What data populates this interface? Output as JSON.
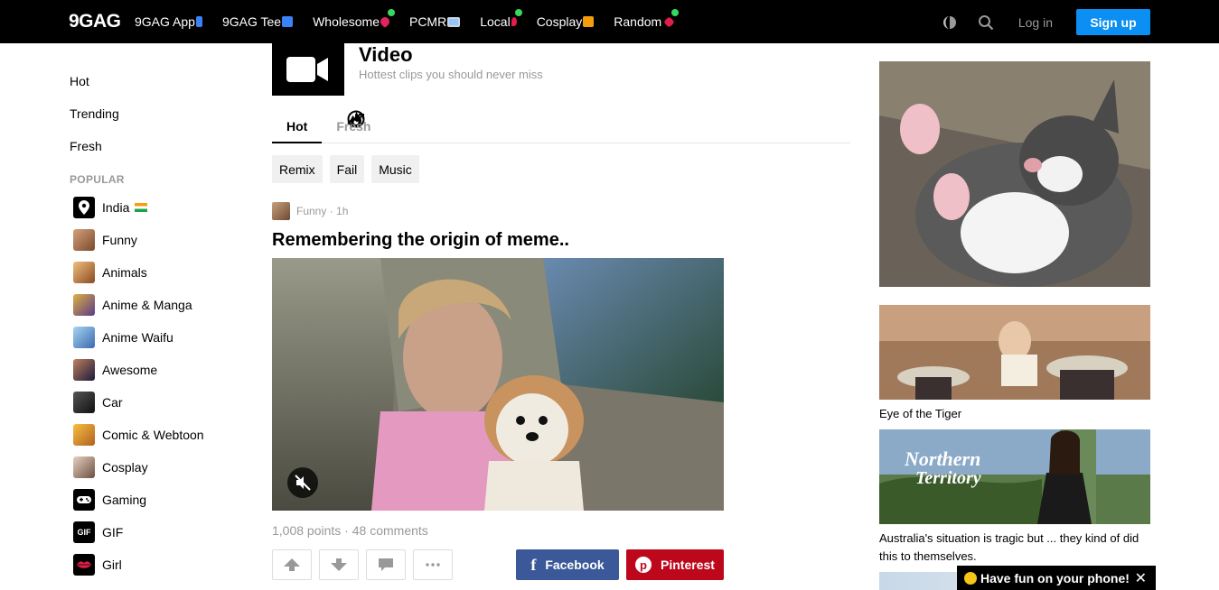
{
  "topbar": {
    "logo": "9GAG",
    "nav": [
      {
        "label": "9GAG App",
        "icon": "phone-icon",
        "color": "#3b82f6",
        "dot": false
      },
      {
        "label": "9GAG Tee",
        "icon": "tshirt-icon",
        "color": "#3b82f6",
        "dot": false
      },
      {
        "label": "Wholesome",
        "icon": "heart-icon",
        "color": "#e0245e",
        "dot": true
      },
      {
        "label": "PCMR",
        "icon": "monitor-icon",
        "color": "#93c5fd",
        "dot": false
      },
      {
        "label": "Local",
        "icon": "pin-icon",
        "color": "#e11d48",
        "dot": true
      },
      {
        "label": "Cosplay",
        "icon": "mask-icon",
        "color": "#f59e0b",
        "dot": false
      },
      {
        "label": "Random",
        "icon": "dice-icon",
        "color": "#e11d48",
        "dot": true
      }
    ],
    "login_label": "Log in",
    "signup_label": "Sign up"
  },
  "sidebar": {
    "main_items": [
      {
        "label": "Hot",
        "icon": "flame-icon"
      },
      {
        "label": "Trending",
        "icon": "trend-icon"
      },
      {
        "label": "Fresh",
        "icon": "clock-icon"
      }
    ],
    "popular_label": "POPULAR",
    "popular_items": [
      {
        "label": "India",
        "flag": true,
        "color": "#000"
      },
      {
        "label": "Funny",
        "color": "#b07a56"
      },
      {
        "label": "Animals",
        "color": "#c47a3a"
      },
      {
        "label": "Anime & Manga",
        "color": "#7a5a9a"
      },
      {
        "label": "Anime Waifu",
        "color": "#6fa3d8"
      },
      {
        "label": "Awesome",
        "color": "#3d3a5a"
      },
      {
        "label": "Car",
        "color": "#2a2a2a"
      },
      {
        "label": "Comic & Webtoon",
        "color": "#e8a030"
      },
      {
        "label": "Cosplay",
        "color": "#b89a80"
      },
      {
        "label": "Gaming",
        "color": "#000"
      },
      {
        "label": "GIF",
        "color": "#000"
      },
      {
        "label": "Girl",
        "color": "#000"
      }
    ]
  },
  "section": {
    "title": "Video",
    "subtitle": "Hottest clips you should never miss",
    "tabs": [
      {
        "label": "Hot",
        "active": true
      },
      {
        "label": "Fresh",
        "active": false
      }
    ],
    "chips": [
      "Remix",
      "Fail",
      "Music"
    ]
  },
  "post": {
    "category": "Funny",
    "time": "1h",
    "title": "Remembering the origin of meme..",
    "points": "1,008 points",
    "comments": "48 comments",
    "facebook_label": "Facebook",
    "pinterest_label": "Pinterest"
  },
  "right": {
    "items": [
      {
        "caption": ""
      },
      {
        "caption": "Eye of the Tiger"
      },
      {
        "caption": "Australia's situation is tragic but ... they kind of did this to themselves.",
        "overlay_text": "Northern Territory"
      }
    ]
  },
  "banner": {
    "label": "Have fun on your phone!",
    "close": "✕"
  }
}
